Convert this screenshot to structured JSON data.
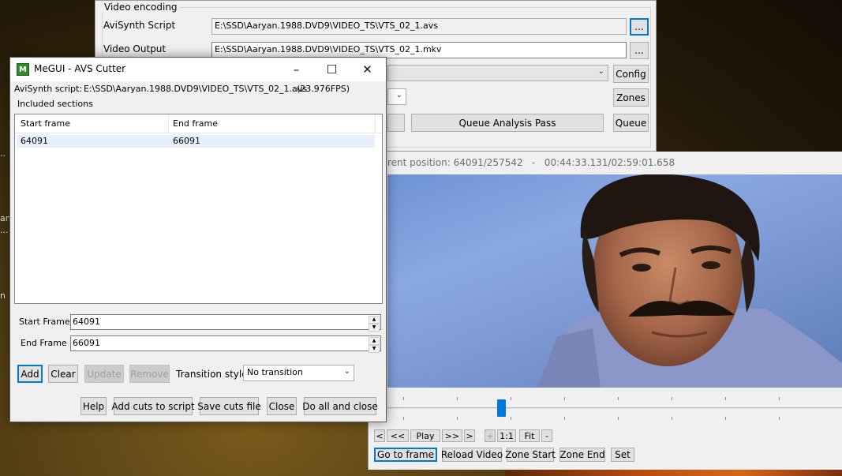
{
  "desktop": {
    "fragments": [
      "..",
      "an",
      "...",
      "n"
    ]
  },
  "main_window": {
    "group_title": "Video encoding",
    "avisynth_label": "AviSynth Script",
    "avisynth_value": "E:\\SSD\\Aaryan.1988.DVD9\\VIDEO_TS\\VTS_02_1.avs",
    "browse_label": "...",
    "video_output_label": "Video Output",
    "video_output_value": "E:\\SSD\\Aaryan.1988.DVD9\\VIDEO_TS\\VTS_02_1.mkv",
    "browse2_label": "...",
    "config_label": "Config",
    "zones_label": "Zones",
    "queue_analysis_label": "Queue Analysis Pass",
    "queue_label": "Queue"
  },
  "preview": {
    "position_text": "rent position: 64091/257542   -   00:44:33.131/02:59:01.658",
    "trackbar_fraction": 0.249,
    "nav_buttons": [
      "<",
      "<<",
      "Play",
      ">>",
      ">",
      "+",
      "1:1",
      "Fit",
      "-"
    ],
    "action_buttons": [
      "Go to frame",
      "Reload Video",
      "Zone Start",
      "Zone End",
      "Set"
    ]
  },
  "dialog": {
    "title": "MeGUI - AVS Cutter",
    "icon_glyph": "M",
    "script_label": "AviSynth script:",
    "script_value": "E:\\SSD\\Aaryan.1988.DVD9\\VIDEO_TS\\VTS_02_1.avs",
    "fps_value": "(23.976FPS)",
    "sections_label": "Included sections",
    "columns": [
      "Start frame",
      "End frame"
    ],
    "rows": [
      {
        "start": "64091",
        "end": "66091"
      }
    ],
    "start_frame_label": "Start Frame",
    "start_frame_value": "64091",
    "end_frame_label": "End Frame",
    "end_frame_value": "66091",
    "add_label": "Add",
    "clear_label": "Clear",
    "update_label": "Update",
    "remove_label": "Remove",
    "transition_label": "Transition style",
    "transition_value": "No transition",
    "help_label": "Help",
    "add_cuts_label": "Add cuts to script",
    "save_cuts_label": "Save cuts file",
    "close_label": "Close",
    "do_all_label": "Do all and close"
  }
}
